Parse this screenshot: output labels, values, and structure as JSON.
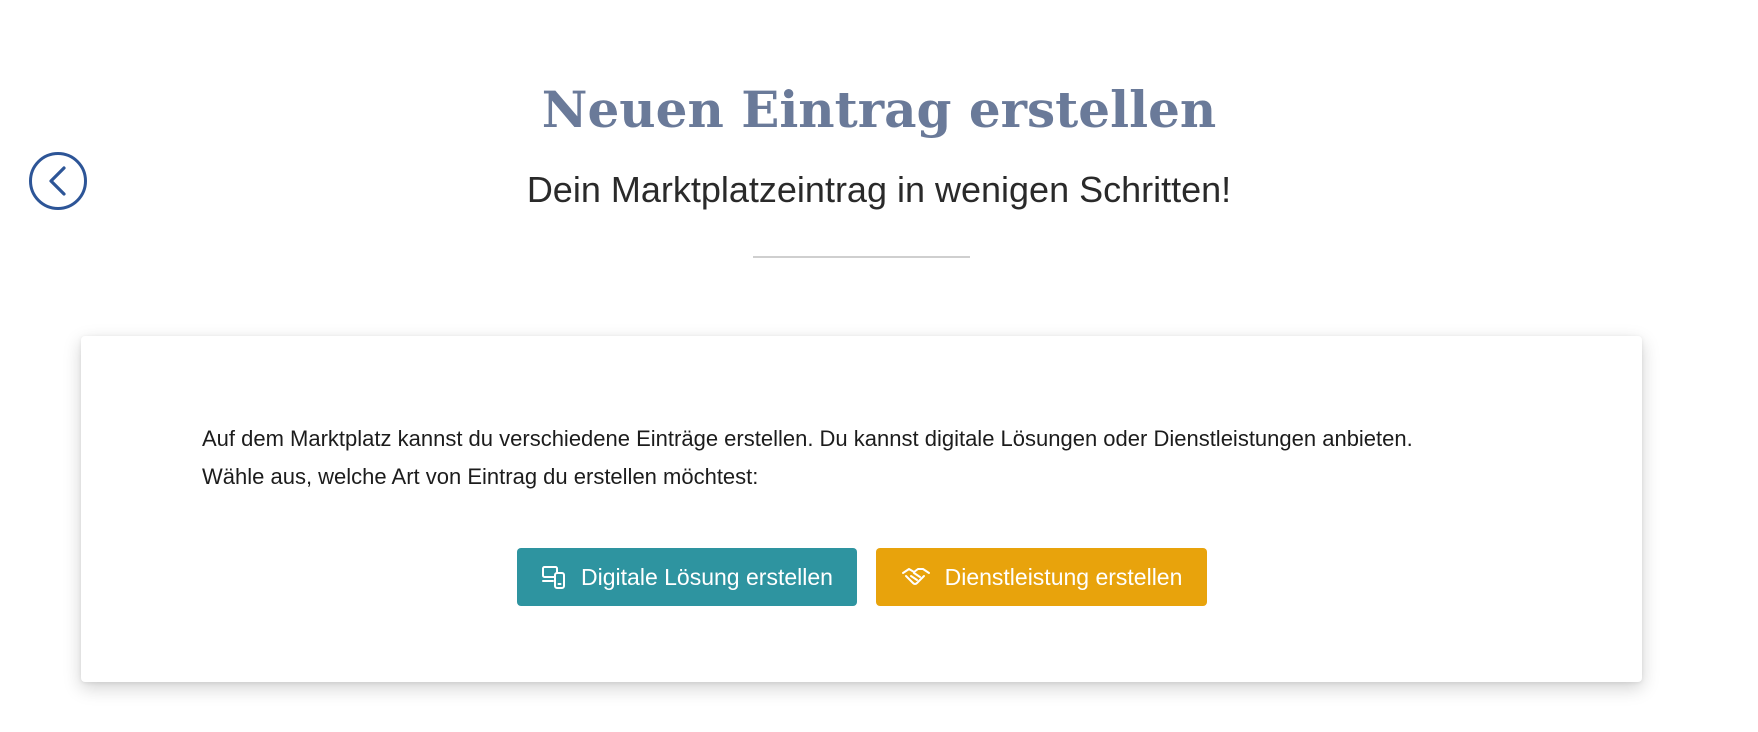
{
  "header": {
    "title": "Neuen Eintrag erstellen",
    "subtitle": "Dein Marktplatzeintrag in wenigen Schritten!"
  },
  "navigation": {
    "back_icon": "chevron-left-circle-icon"
  },
  "card": {
    "line1": "Auf dem Marktplatz kannst du verschiedene Einträge erstellen. Du kannst digitale Lösungen oder Dienstleistungen anbieten.",
    "line2": "Wähle aus, welche Art von Eintrag du erstellen möchtest:"
  },
  "actions": {
    "digital_label": "Digitale Lösung erstellen",
    "digital_icon": "devices-icon",
    "digital_color": "#2e94a0",
    "service_label": "Dienstleistung erstellen",
    "service_icon": "handshake-icon",
    "service_color": "#e8a30c"
  },
  "colors": {
    "title": "#6a7a99",
    "accent": "#2d5597"
  }
}
